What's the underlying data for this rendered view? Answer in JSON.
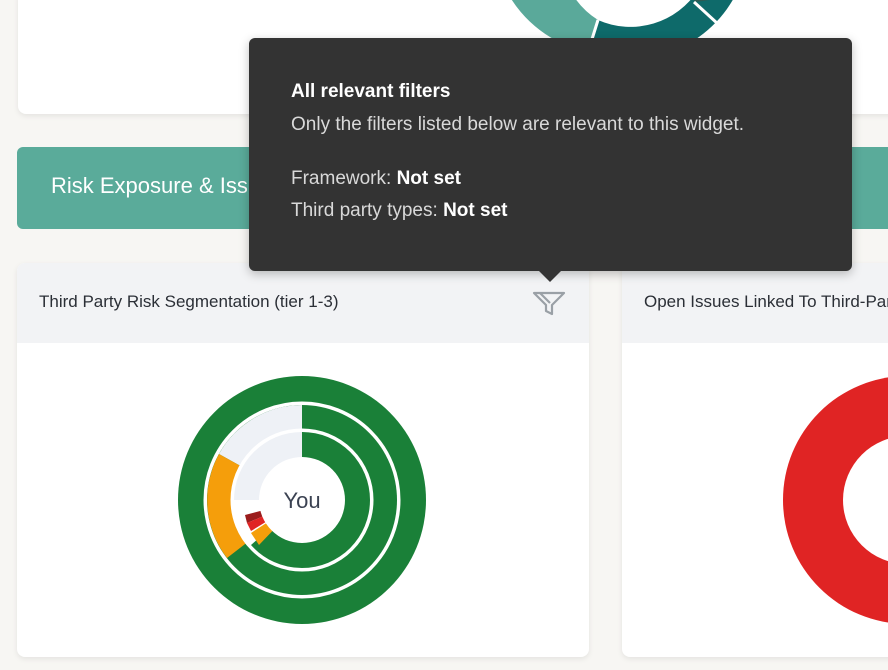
{
  "colors": {
    "banner": "#5aab9a",
    "tooltip_bg": "#333333",
    "green": "#1a8038",
    "orange": "#f59e0b",
    "red": "#e02424",
    "dark_red": "#9b1c1c",
    "teal_light": "#5aa99a",
    "teal_dark": "#0e6a6a"
  },
  "section": {
    "title": "Risk Exposure & Issues"
  },
  "widgets": {
    "left": {
      "title": "Third Party Risk Segmentation (tier 1-3)",
      "center_label": "You",
      "filter_icon": "filter-icon"
    },
    "right": {
      "title": "Open Issues Linked To Third-Party"
    }
  },
  "tooltip": {
    "title": "All relevant filters",
    "description": "Only the filters listed below are relevant to this widget.",
    "filters": [
      {
        "label": "Framework:",
        "value": "Not set"
      },
      {
        "label": "Third party types:",
        "value": "Not set"
      }
    ]
  }
}
